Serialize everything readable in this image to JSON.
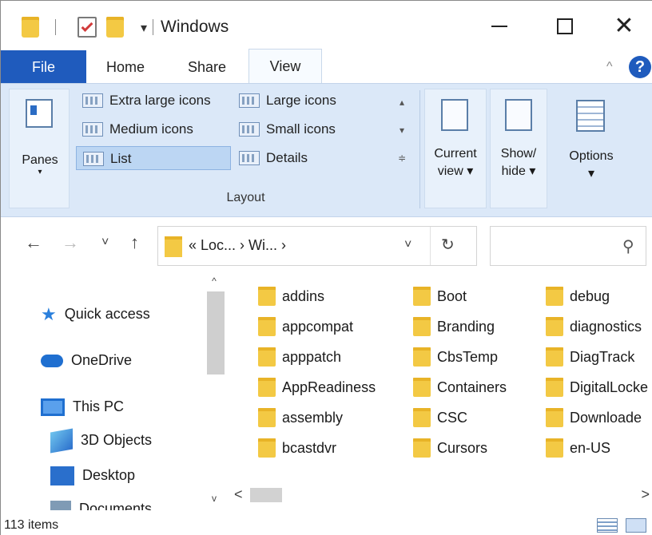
{
  "window": {
    "title": "Windows",
    "qat_dropdown": "▾",
    "minimize": "",
    "maximize": "",
    "close": "✕"
  },
  "tabs": [
    "File",
    "Home",
    "Share",
    "View"
  ],
  "ribbon": {
    "collapse_caret": "^",
    "help": "?",
    "panes": {
      "label": "Panes",
      "arrow": "▾"
    },
    "layout": {
      "items": [
        "Extra large icons",
        "Large icons",
        "Medium icons",
        "Small icons",
        "List",
        "Details"
      ],
      "selected": "List",
      "group_label": "Layout"
    },
    "current_view": {
      "line1": "Current",
      "line2": "view ▾"
    },
    "show_hide": {
      "line1": "Show/",
      "line2": "hide ▾"
    },
    "options": {
      "line1": "Options",
      "line2": "▾"
    }
  },
  "navigation": {
    "back": "←",
    "forward": "→",
    "recent": "˅",
    "up": "↑",
    "address_path": "« Loc... › Wi... ›",
    "address_dropdown": "˅",
    "refresh": "↻",
    "search_placeholder": "",
    "search_icon": "⚲"
  },
  "nav_pane": {
    "items": [
      "Quick access",
      "OneDrive",
      "This PC",
      "3D Objects",
      "Desktop",
      "Documents"
    ],
    "scroll_up": "^",
    "scroll_down": "v"
  },
  "files": {
    "col1": [
      "addins",
      "appcompat",
      "apppatch",
      "AppReadiness",
      "assembly",
      "bcastdvr"
    ],
    "col2": [
      "Boot",
      "Branding",
      "CbsTemp",
      "Containers",
      "CSC",
      "Cursors"
    ],
    "col3": [
      "debug",
      "diagnostics",
      "DiagTrack",
      "DigitalLocke",
      "Downloade",
      "en-US"
    ]
  },
  "hscroll": {
    "left": "<",
    "right": ">"
  },
  "status": {
    "item_count": "113 items"
  },
  "colors": {
    "accent": "#1f5bbd",
    "folder": "#f3c944",
    "ribbon_bg": "#dbe8f8"
  }
}
